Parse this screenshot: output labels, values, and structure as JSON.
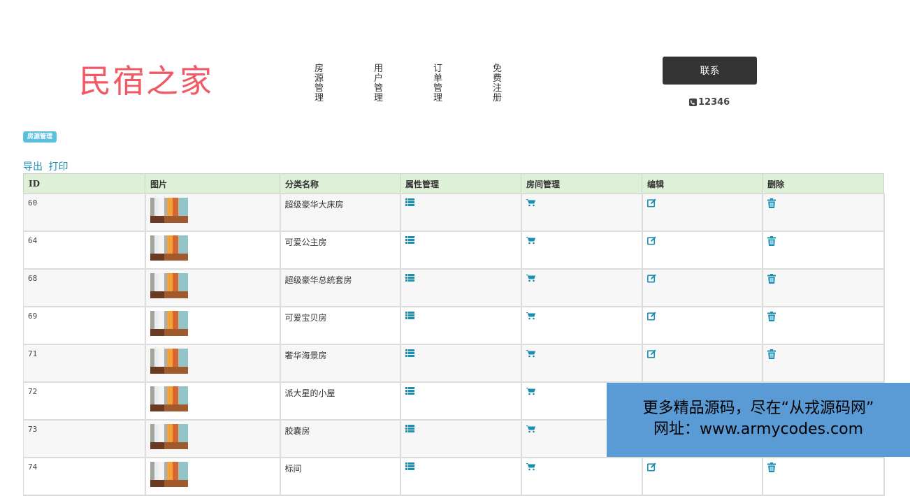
{
  "logo_text": "民宿之家",
  "nav": [
    {
      "label": "房源管理"
    },
    {
      "label": "用户管理"
    },
    {
      "label": "订单管理"
    },
    {
      "label": "免费注册"
    }
  ],
  "contact_button": "联系",
  "phone": "12346",
  "badge": "房源管理",
  "actions": {
    "export": "导出",
    "print": "打印"
  },
  "table": {
    "headers": [
      "ID",
      "图片",
      "分类名称",
      "属性管理",
      "房间管理",
      "编辑",
      "删除"
    ],
    "rows": [
      {
        "id": "60",
        "name": "超级豪华大床房"
      },
      {
        "id": "64",
        "name": "可爱公主房"
      },
      {
        "id": "68",
        "name": "超级豪华总统套房"
      },
      {
        "id": "69",
        "name": "可爱宝贝房"
      },
      {
        "id": "71",
        "name": "奢华海景房"
      },
      {
        "id": "72",
        "name": "派大星的小屋"
      },
      {
        "id": "73",
        "name": "胶囊房"
      },
      {
        "id": "74",
        "name": "标间"
      }
    ]
  },
  "watermark": {
    "line1": "更多精品源码，尽在“从戎源码网”",
    "line2": "网址：www.armycodes.com"
  },
  "colors": {
    "accent": "#1a8fb0",
    "logo": "#f05a66",
    "header_bg": "#dff0d8",
    "watermark_bg": "#5b9bd5"
  }
}
